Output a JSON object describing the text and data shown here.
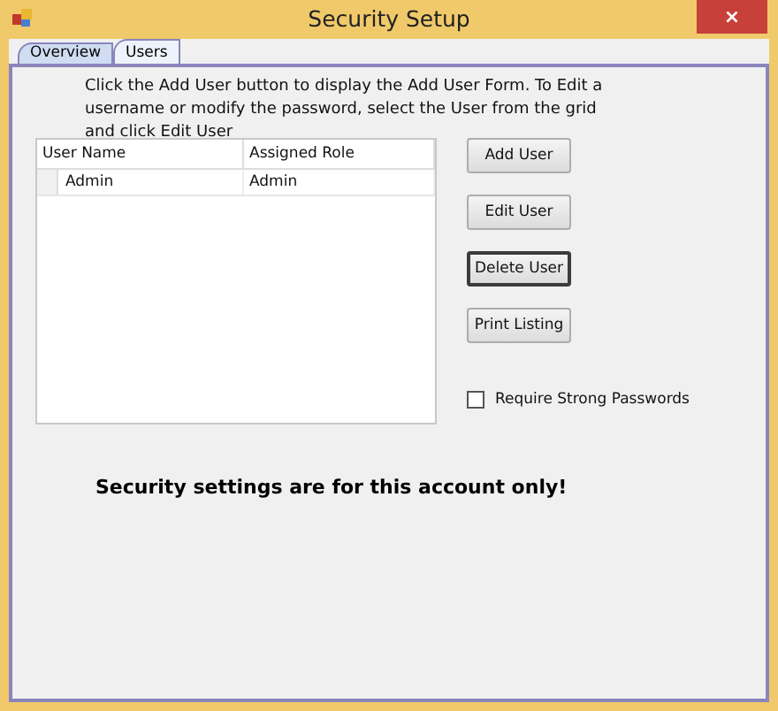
{
  "window": {
    "title": "Security Setup",
    "close": "×"
  },
  "tabs": [
    {
      "label": "Overview",
      "selected": false
    },
    {
      "label": "Users",
      "selected": true
    }
  ],
  "instructions": "Click the Add User button to display the Add User Form.  To Edit a username or modify the password, select the User from the grid and click Edit User",
  "grid": {
    "columns": [
      "User Name",
      "Assigned Role"
    ],
    "rows": [
      [
        "Admin",
        "Admin"
      ]
    ]
  },
  "buttons": [
    {
      "label": "Add User",
      "default": false
    },
    {
      "label": "Edit User",
      "default": false
    },
    {
      "label": "Delete User",
      "default": true
    },
    {
      "label": "Print Listing",
      "default": false
    }
  ],
  "require_strong_passwords": {
    "label": "Require Strong Passwords",
    "checked": false
  },
  "notice": "Security settings are for this account only!"
}
